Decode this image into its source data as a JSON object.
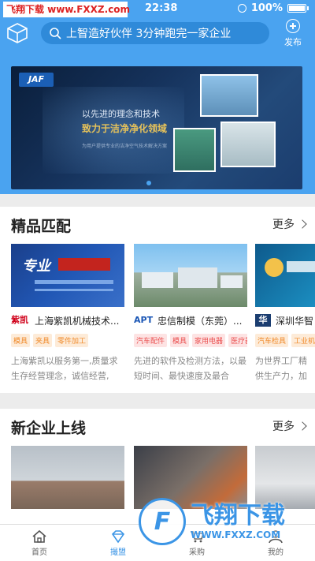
{
  "status_bar": {
    "watermark": "飞翔下载 www.FXXZ.com",
    "time": "22:38",
    "battery": "100%"
  },
  "header": {
    "search_placeholder": "上智造好伙伴 3分钟跑完一家企业",
    "publish_label": "发布"
  },
  "banner": {
    "brand": "JAF",
    "line1": "以先进的理念和技术",
    "line2": "致力于洁净净化领域",
    "line3": "为用户提供专业的洁净空气技术解决方案"
  },
  "section_featured": {
    "title": "精品匹配",
    "more": "更多",
    "cards": [
      {
        "logo": "紫凯",
        "name": "上海紫凯机械技术...",
        "tags": [
          "模具",
          "夹具",
          "零件加工"
        ],
        "desc": "上海紫凯以服务第一,质量求生存经营理念，诚信经营,"
      },
      {
        "logo": "APT",
        "name": "忠信制模（东莞）...",
        "tags": [
          "汽车配件",
          "模具",
          "家用电器",
          "医疗器械"
        ],
        "desc": "先进的软件及检测方法，以最短时间、最快速度及最合"
      },
      {
        "logo": "华",
        "name": "深圳华智",
        "tags": [
          "汽车检具",
          "工业机械"
        ],
        "desc": "为世界工厂精供生产力，加"
      }
    ]
  },
  "section_new": {
    "title": "新企业上线",
    "more": "更多"
  },
  "tabbar": {
    "items": [
      {
        "label": "首页"
      },
      {
        "label": "撮盟"
      },
      {
        "label": "采购"
      },
      {
        "label": "我的"
      }
    ]
  },
  "watermark_brand": {
    "cn": "飞翔下载",
    "en": "WWW.FXXZ.COM"
  },
  "colors": {
    "primary": "#4aa3f0",
    "tag_orange": "#f08a2a",
    "tag_red": "#ea5050"
  }
}
